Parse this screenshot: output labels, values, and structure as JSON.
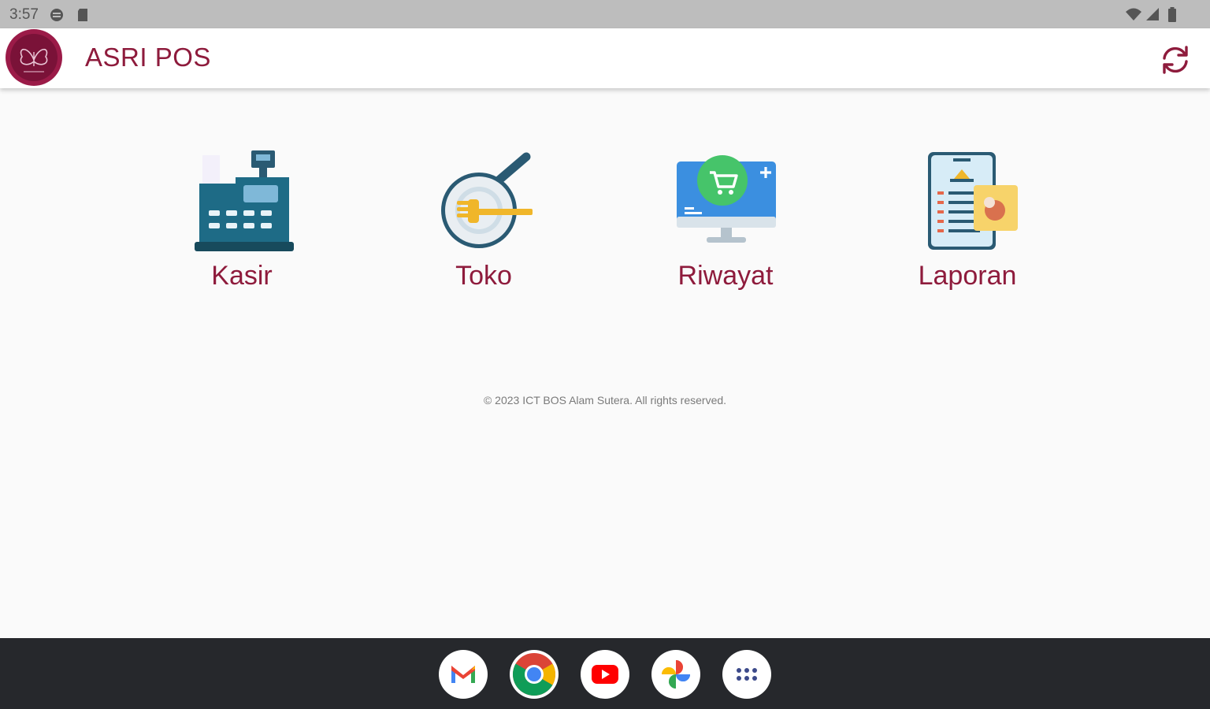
{
  "status_bar": {
    "time": "3:57"
  },
  "app_bar": {
    "title": "ASRI POS"
  },
  "menu": [
    {
      "label": "Kasir",
      "icon": "cash-register-icon"
    },
    {
      "label": "Toko",
      "icon": "plate-fork-knife-icon"
    },
    {
      "label": "Riwayat",
      "icon": "computer-cart-icon"
    },
    {
      "label": "Laporan",
      "icon": "report-document-icon"
    }
  ],
  "footer": {
    "copyright": "© 2023 ICT BOS Alam Sutera. All rights reserved."
  },
  "dock": [
    "Gmail",
    "Chrome",
    "YouTube",
    "Photos",
    "App drawer"
  ],
  "colors": {
    "accent": "#8e1b3c",
    "status_bar": "#bdbdbd",
    "nav_bar": "#26282c",
    "background": "#fafafa"
  }
}
